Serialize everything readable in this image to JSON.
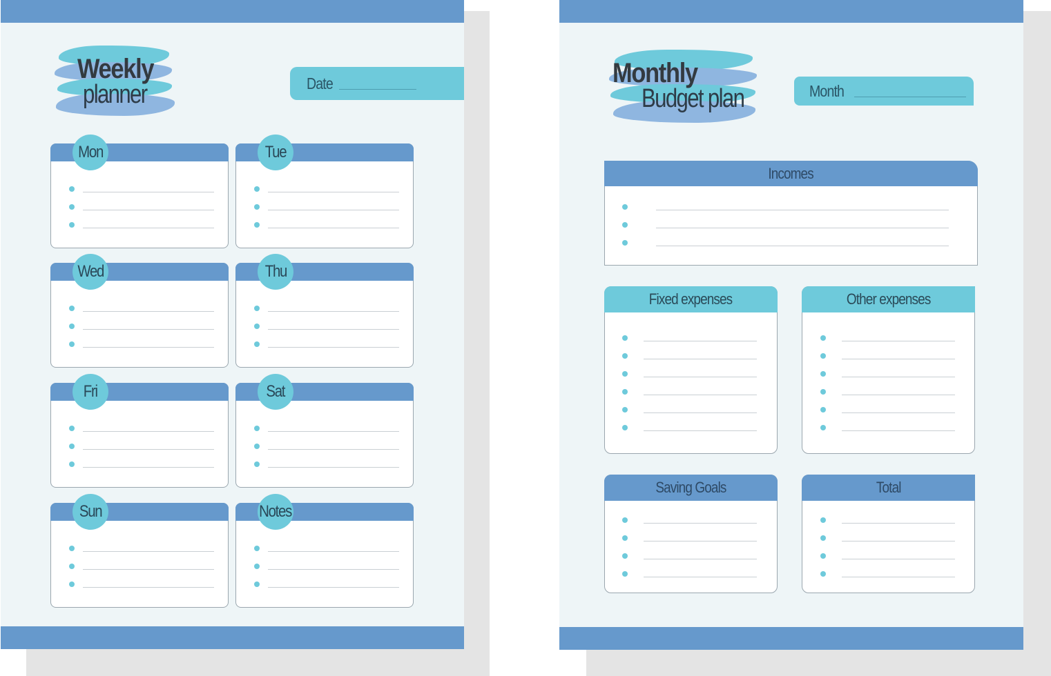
{
  "colors": {
    "band": "#6699cc",
    "accent": "#6ecadb",
    "page_bg": "#eef5f7",
    "shadow": "#e4e4e4",
    "title_text": "#333a40"
  },
  "weekly": {
    "title_bold": "Weekly",
    "title_light": "planner",
    "date_label": "Date",
    "days": [
      {
        "label": "Mon",
        "items": 3
      },
      {
        "label": "Tue",
        "items": 3
      },
      {
        "label": "Wed",
        "items": 3
      },
      {
        "label": "Thu",
        "items": 3
      },
      {
        "label": "Fri",
        "items": 3
      },
      {
        "label": "Sat",
        "items": 3
      },
      {
        "label": "Sun",
        "items": 3
      },
      {
        "label": "Notes",
        "items": 3
      }
    ]
  },
  "budget": {
    "title_bold": "Monthly",
    "title_light": "Budget plan",
    "month_label": "Month",
    "sections": {
      "incomes": {
        "label": "Incomes",
        "items": 3
      },
      "fixed": {
        "label": "Fixed expenses",
        "items": 6
      },
      "other": {
        "label": "Other expenses",
        "items": 6
      },
      "saving": {
        "label": "Saving Goals",
        "items": 4
      },
      "total": {
        "label": "Total",
        "items": 4
      }
    }
  }
}
